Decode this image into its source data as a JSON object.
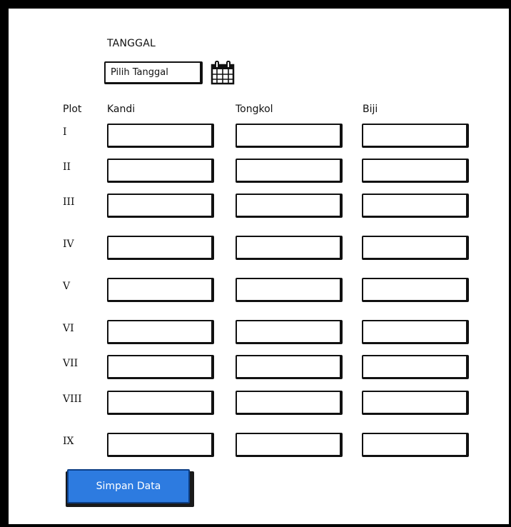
{
  "form": {
    "date_label": "TANGGAL",
    "date_placeholder": "Pilih Tanggal",
    "calendar_icon": "calendar-icon",
    "columns": {
      "plot": "Plot",
      "kandi": "Kandi",
      "tongkol": "Tongkol",
      "biji": "Biji"
    },
    "rows": [
      {
        "label": "I"
      },
      {
        "label": "II"
      },
      {
        "label": "III"
      },
      {
        "label": "IV"
      },
      {
        "label": "V"
      },
      {
        "label": "VI"
      },
      {
        "label": "VII"
      },
      {
        "label": "VIII"
      },
      {
        "label": "IX"
      }
    ],
    "save_label": "Simpan Data",
    "accent_color": "#2d7be0"
  }
}
